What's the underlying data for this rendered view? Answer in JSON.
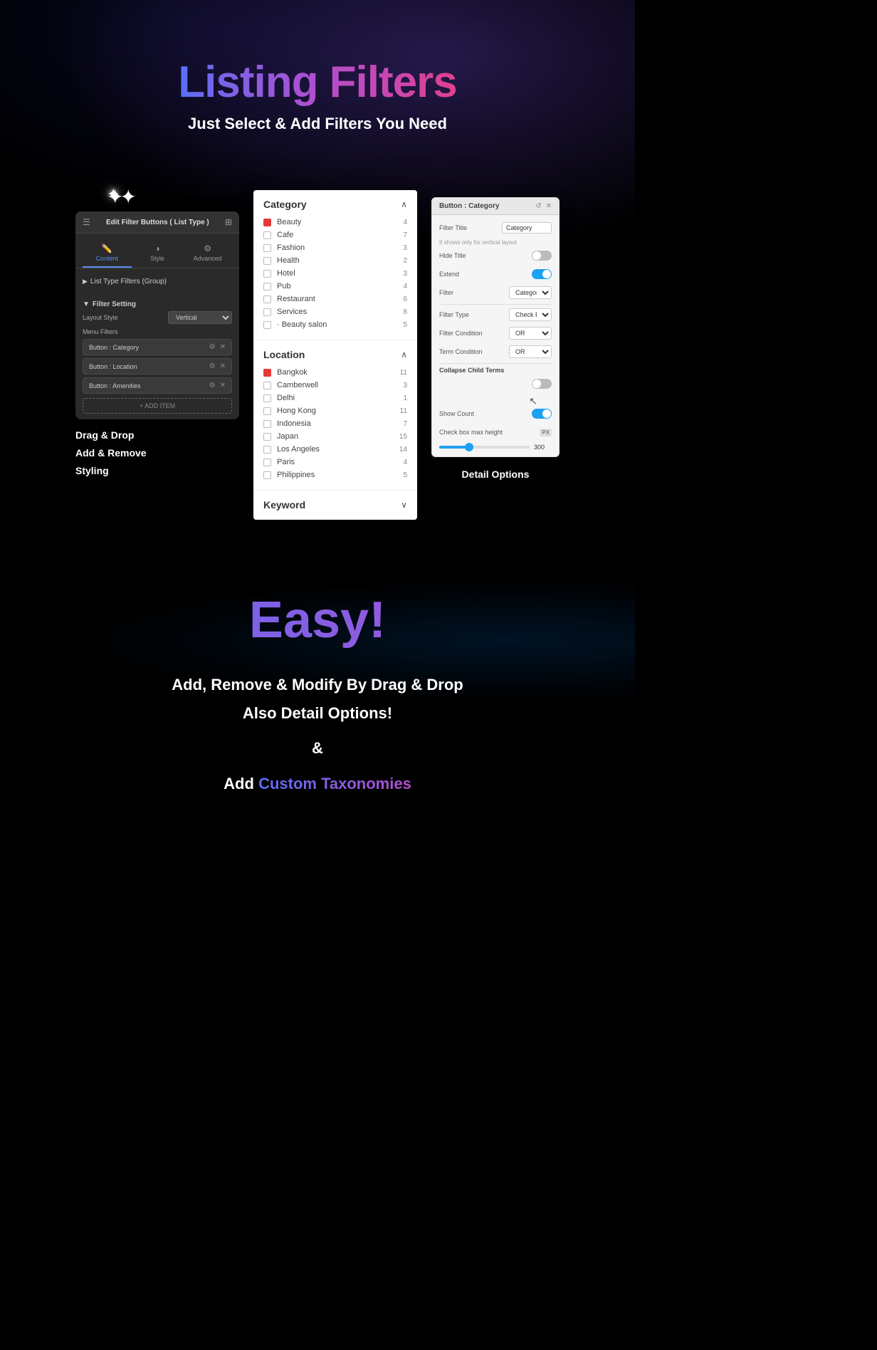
{
  "page": {
    "background": "#000000"
  },
  "header": {
    "title": "Listing Filters",
    "subtitle": "Just Select & Add Filters You Need"
  },
  "left_panel": {
    "title": "Edit Filter Buttons ( List Type )",
    "tabs": [
      {
        "label": "Content",
        "icon": "✏️",
        "active": true
      },
      {
        "label": "Style",
        "icon": "◑",
        "active": false
      },
      {
        "label": "Advanced",
        "icon": "⚙️",
        "active": false
      }
    ],
    "group_label": "List Type Filters (Group)",
    "filter_setting_label": "Filter Setting",
    "layout_label": "Layout Style",
    "layout_value": "Vertical",
    "menu_filters_label": "Menu Filters",
    "filter_items": [
      {
        "name": "Button : Category"
      },
      {
        "name": "Button : Location"
      },
      {
        "name": "Button : Amenities"
      }
    ],
    "add_item_label": "+ ADD ITEM",
    "labels": {
      "drag_drop": "Drag & Drop",
      "add_remove": "Add & Remove",
      "styling": "Styling"
    }
  },
  "center_panel": {
    "sections": [
      {
        "title": "Category",
        "expanded": true,
        "items": [
          {
            "name": "Beauty",
            "count": 4,
            "checked": true
          },
          {
            "name": "Cafe",
            "count": 7,
            "checked": false
          },
          {
            "name": "Fashion",
            "count": 3,
            "checked": false
          },
          {
            "name": "Health",
            "count": 2,
            "checked": false
          },
          {
            "name": "Hotel",
            "count": 3,
            "checked": false
          },
          {
            "name": "Pub",
            "count": 4,
            "checked": false
          },
          {
            "name": "Restaurant",
            "count": 6,
            "checked": false
          },
          {
            "name": "Services",
            "count": 8,
            "checked": false
          },
          {
            "name": "· Beauty salon",
            "count": 5,
            "checked": false
          }
        ]
      },
      {
        "title": "Location",
        "expanded": true,
        "items": [
          {
            "name": "Bangkok",
            "count": 11,
            "checked": true
          },
          {
            "name": "Camberwell",
            "count": 3,
            "checked": false
          },
          {
            "name": "Delhi",
            "count": 1,
            "checked": false
          },
          {
            "name": "Hong Kong",
            "count": 11,
            "checked": false
          },
          {
            "name": "Indonesia",
            "count": 7,
            "checked": false
          },
          {
            "name": "Japan",
            "count": 15,
            "checked": false
          },
          {
            "name": "Los Angeles",
            "count": 14,
            "checked": false
          },
          {
            "name": "Paris",
            "count": 4,
            "checked": false
          },
          {
            "name": "Philippines",
            "count": 5,
            "checked": false
          }
        ]
      },
      {
        "title": "Keyword",
        "expanded": false,
        "items": []
      }
    ]
  },
  "right_panel": {
    "title": "Button : Category",
    "filter_title_label": "Filter Title",
    "filter_title_value": "Category",
    "hint": "It shows only for vertical layout",
    "hide_title_label": "Hide Title",
    "hide_title_on": false,
    "extend_label": "Extend",
    "extend_on": true,
    "filter_label": "Filter",
    "filter_value": "Category",
    "filter_type_label": "Filter Type",
    "filter_type_value": "Check Box",
    "filter_condition_label": "Filter Condition",
    "filter_condition_value": "OR",
    "term_condition_label": "Term Condition",
    "term_condition_value": "OR",
    "collapse_child_label": "Collapse Child Terms",
    "collapse_child_on": false,
    "show_count_label": "Show Count",
    "show_count_on": true,
    "checkbox_max_height_label": "Check box max height",
    "px_label": "PX",
    "slider_value": "300",
    "detail_options_label": "Detail Options"
  },
  "bottom": {
    "easy_title": "Easy!",
    "line1": "Add, Remove & Modify By Drag & Drop",
    "line2": "Also Detail Options!",
    "ampersand": "&",
    "line3_prefix": "Add ",
    "line3_highlight": "Custom Taxonomies"
  }
}
